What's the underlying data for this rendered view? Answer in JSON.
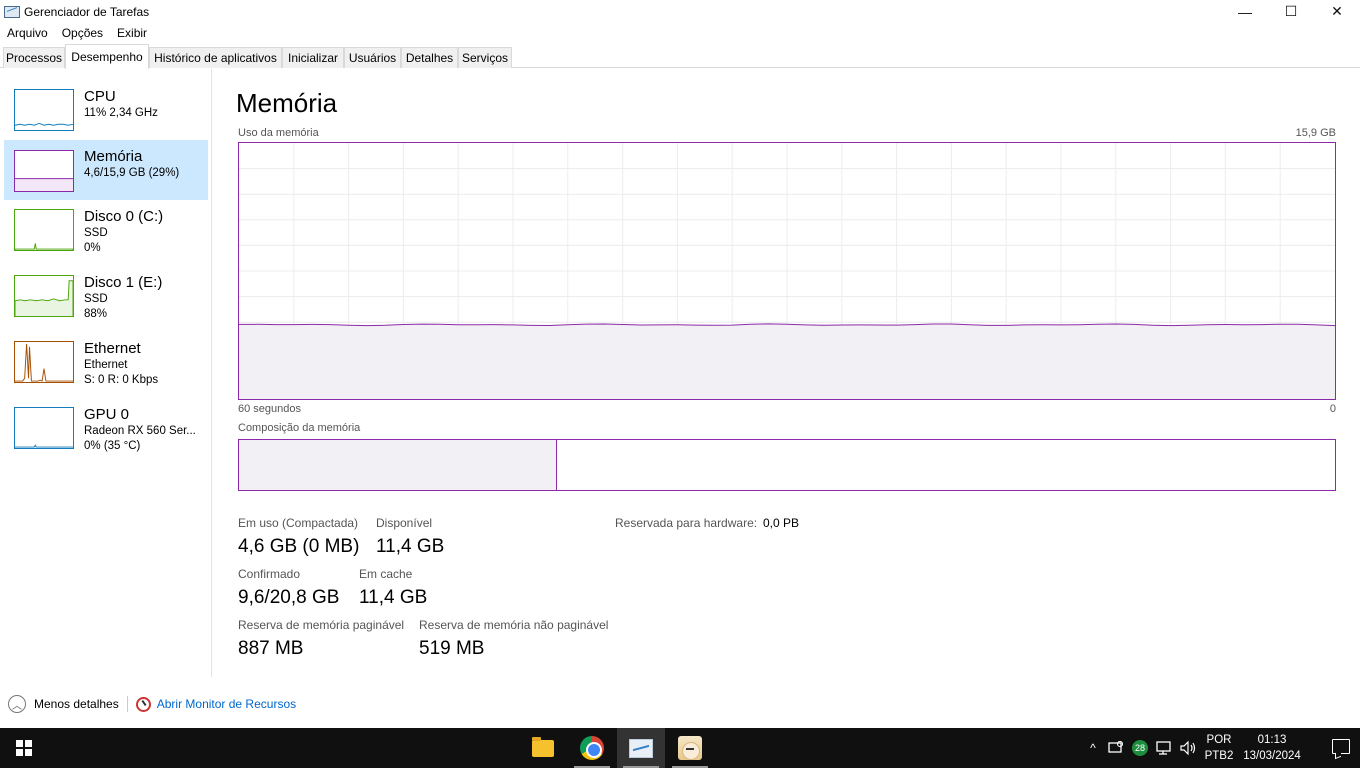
{
  "window": {
    "title": "Gerenciador de Tarefas",
    "minimize_glyph": "—",
    "maximize_glyph": "☐",
    "close_glyph": "✕"
  },
  "menu": [
    "Arquivo",
    "Opções",
    "Exibir"
  ],
  "tabs": [
    "Processos",
    "Desempenho",
    "Histórico de aplicativos",
    "Inicializar",
    "Usuários",
    "Detalhes",
    "Serviços"
  ],
  "active_tab": "Desempenho",
  "sidebar": {
    "items": [
      {
        "title": "CPU",
        "line1": "11% 2,34 GHz",
        "line2": "",
        "color": "#117dbb"
      },
      {
        "title": "Memória",
        "line1": "4,6/15,9 GB (29%)",
        "line2": "",
        "color": "#8b2aa8"
      },
      {
        "title": "Disco 0 (C:)",
        "line1": "SSD",
        "line2": "0%",
        "color": "#4da60c"
      },
      {
        "title": "Disco 1 (E:)",
        "line1": "SSD",
        "line2": "88%",
        "color": "#4da60c"
      },
      {
        "title": "Ethernet",
        "line1": "Ethernet",
        "line2": "S: 0 R: 0 Kbps",
        "color": "#a74f01"
      },
      {
        "title": "GPU 0",
        "line1": "Radeon RX 560 Ser...",
        "line2": "0% (35 °C)",
        "color": "#117dbb"
      }
    ],
    "selected_index": 1
  },
  "main": {
    "title": "Memória",
    "usage_label": "Uso da memória",
    "usage_max": "15,9 GB",
    "time_label": "60 segundos",
    "time_zero": "0",
    "composition_label": "Composição da memória",
    "usage_fraction": 0.29,
    "accent": "#8b2aa8",
    "stats": {
      "in_use_label": "Em uso (Compactada)",
      "in_use_value": "4,6 GB (0 MB)",
      "available_label": "Disponível",
      "available_value": "11,4 GB",
      "hw_reserved_label": "Reservada para hardware:",
      "hw_reserved_value": "0,0 PB",
      "committed_label": "Confirmado",
      "committed_value": "9,6/20,8 GB",
      "cached_label": "Em cache",
      "cached_value": "11,4 GB",
      "paged_label": "Reserva de memória paginável",
      "paged_value": "887 MB",
      "nonpaged_label": "Reserva de memória não paginável",
      "nonpaged_value": "519 MB"
    }
  },
  "footer": {
    "less_details": "Menos detalhes",
    "resource_monitor": "Abrir Monitor de Recursos",
    "chevron_glyph": "︿"
  },
  "taskbar": {
    "apps": [
      "file-explorer",
      "chrome",
      "task-manager",
      "anime-app"
    ],
    "tray_chevron": "^",
    "tray_badge": "28",
    "language": "POR",
    "layout": "PTB2",
    "time": "01:13",
    "date": "13/03/2024"
  }
}
